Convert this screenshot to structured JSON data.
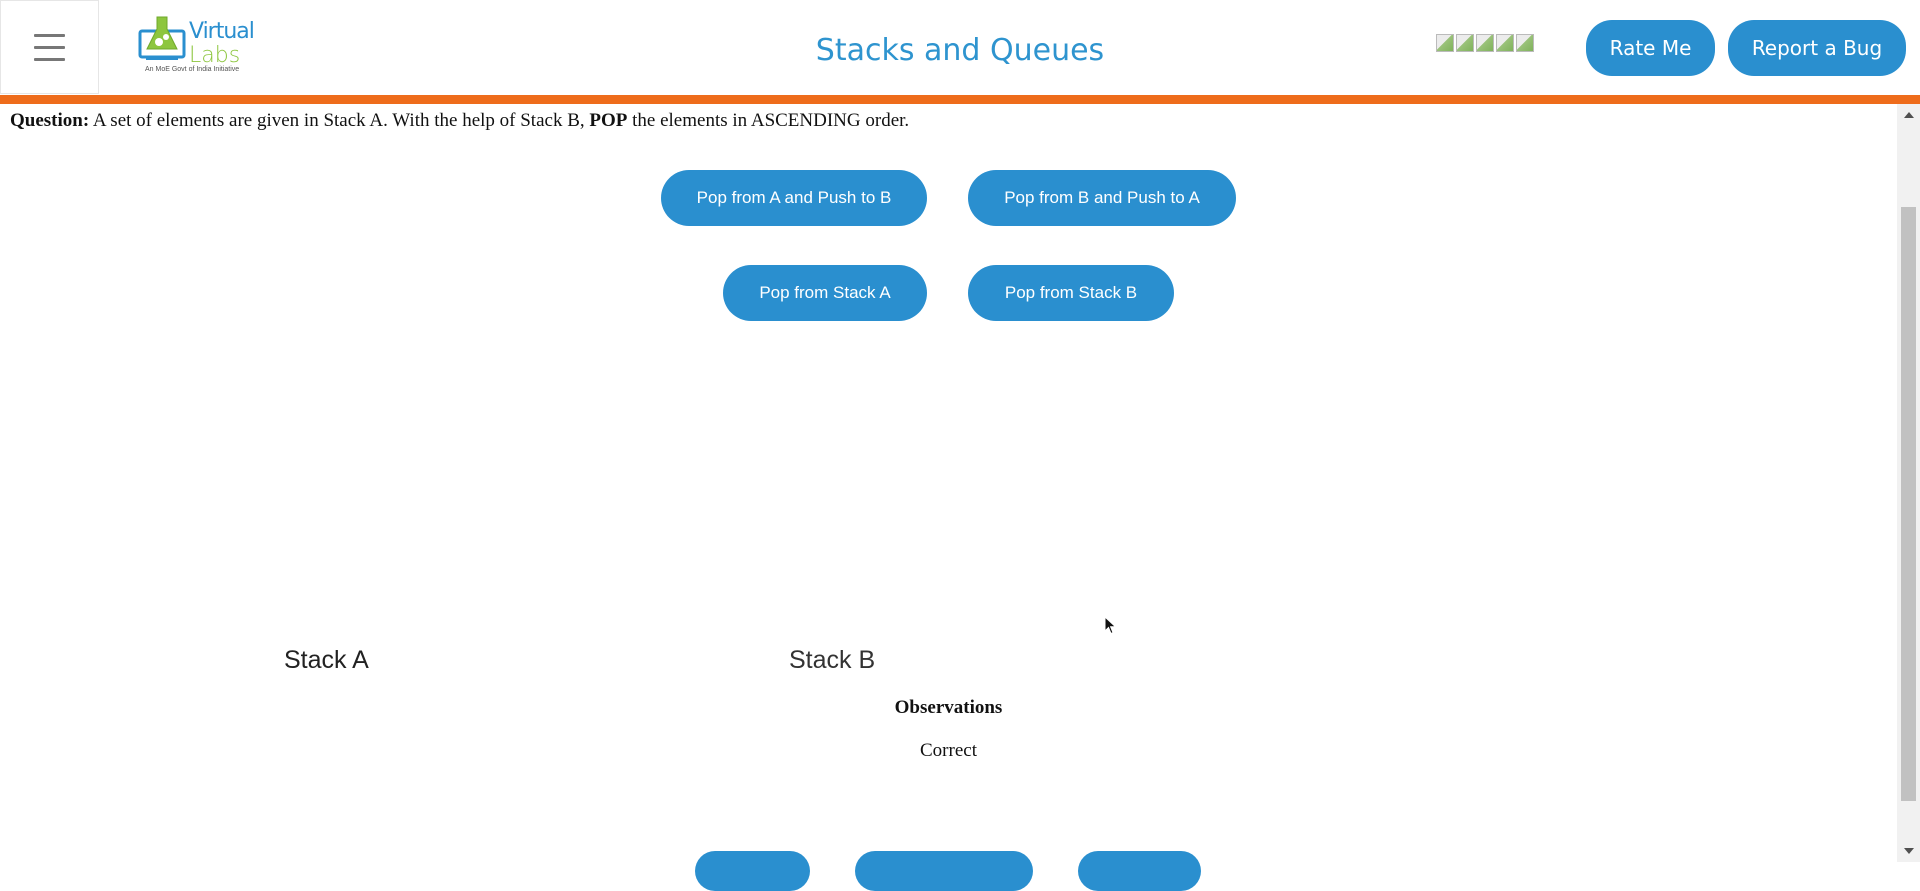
{
  "header": {
    "menu_icon": "hamburger-icon",
    "logo": {
      "word1": "Virtual",
      "word2": "Labs",
      "tagline": "An MoE Govt of India Initiative"
    },
    "title": "Stacks and Queues",
    "rating_icons": [
      "star-rating-icon",
      "star-rating-icon",
      "star-rating-icon",
      "star-rating-icon",
      "star-rating-icon"
    ],
    "rate_label": "Rate Me",
    "bug_label": "Report a Bug"
  },
  "question": {
    "label": "Question:",
    "text_1": " A set of elements are given in Stack A. With the help of Stack B, ",
    "bold_word": "POP",
    "text_2": " the elements in ASCENDING order."
  },
  "actions": {
    "pop_a_push_b": "Pop from A and Push to B",
    "pop_b_push_a": "Pop from B and Push to A",
    "pop_a": "Pop from Stack A",
    "pop_b": "Pop from Stack B"
  },
  "stacks": {
    "a_label": "Stack A",
    "b_label": "Stack B"
  },
  "observations": {
    "title": "Observations",
    "text": "Correct"
  },
  "colors": {
    "accent": "#2a8fcf",
    "title": "#2e94cf",
    "header_bar": "#ee6c1b",
    "logo_green": "#8dc63f"
  }
}
